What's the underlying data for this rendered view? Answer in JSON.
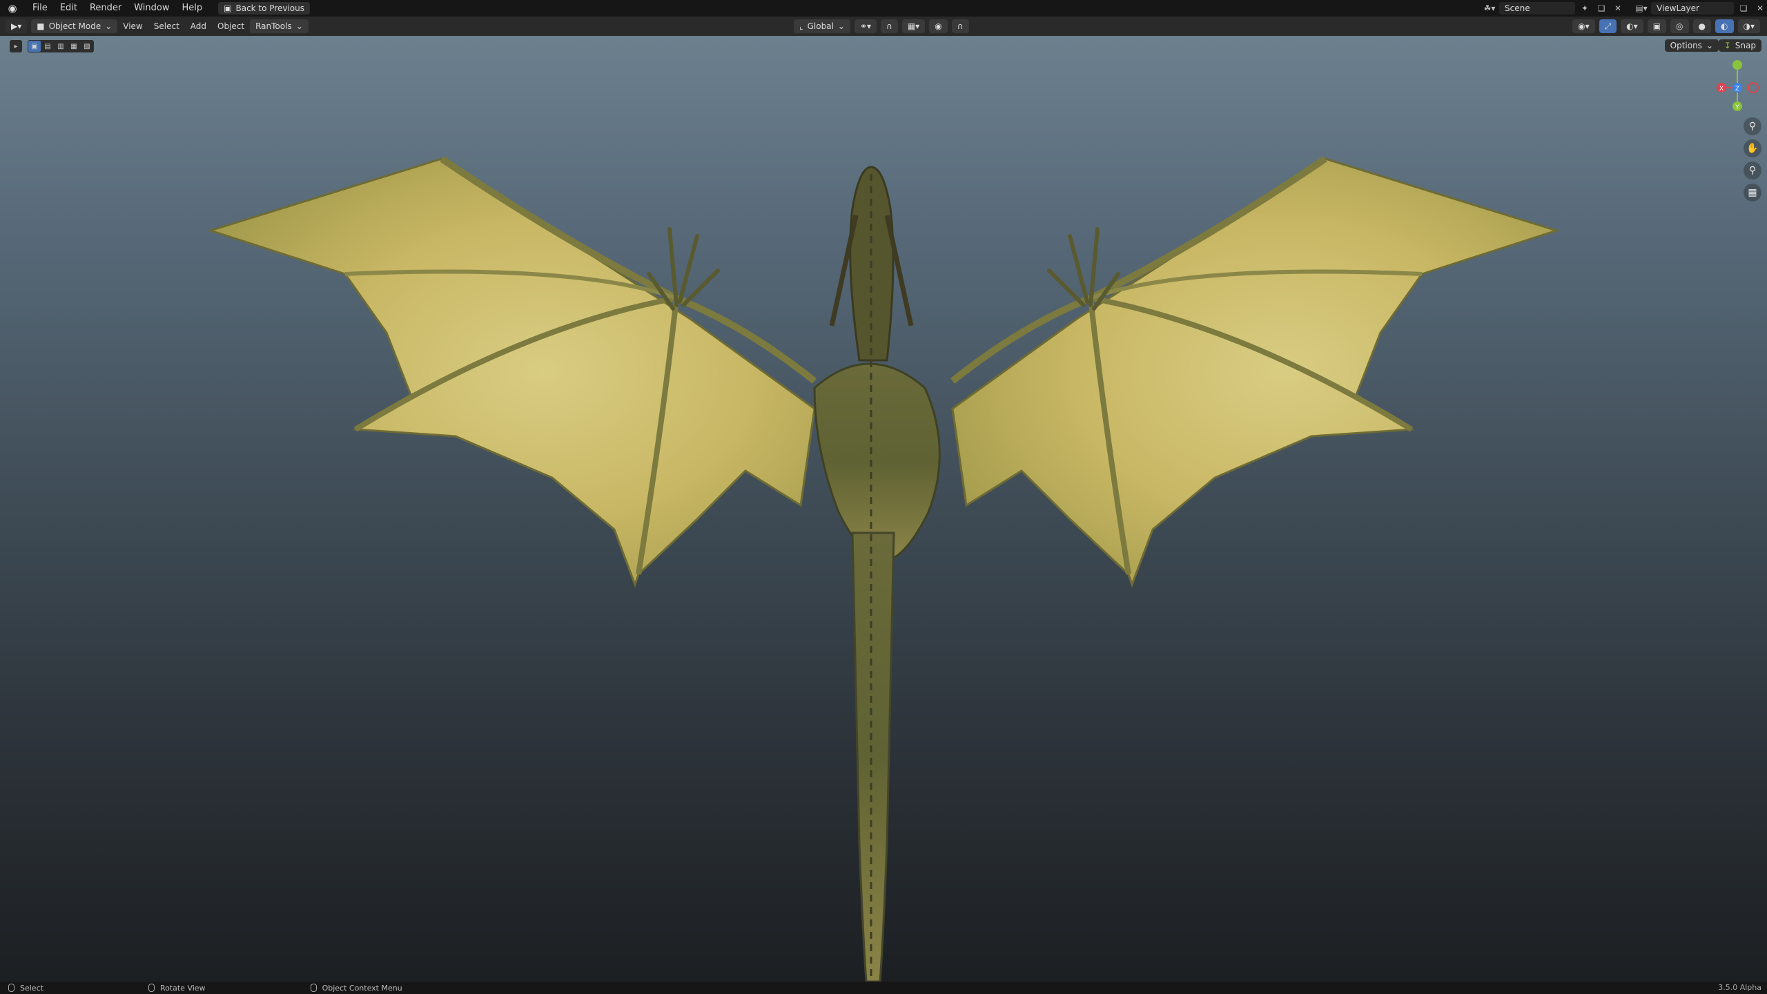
{
  "topbar": {
    "menus": [
      "File",
      "Edit",
      "Render",
      "Window",
      "Help"
    ],
    "back_button": "Back to Previous",
    "scene_label": "Scene",
    "view_layer_label": "ViewLayer"
  },
  "header": {
    "mode": "Object Mode",
    "menus": [
      "View",
      "Select",
      "Add",
      "Object",
      "RanTools"
    ],
    "transform_orientation": "Global",
    "options_label": "Options",
    "snap_label": "Snap"
  },
  "gizmo": {
    "x_label": "X",
    "y_label": "Y",
    "z_label": "Z",
    "colors": {
      "x": "#e0434f",
      "y": "#8ac43c",
      "z": "#3b82e8"
    }
  },
  "statusbar": {
    "items": [
      "Select",
      "Rotate View",
      "Object Context Menu"
    ],
    "version": "3.5.0 Alpha"
  },
  "icons": {
    "logo": "blender-logo-icon",
    "zoom": "zoom-icon",
    "pan": "hand-icon",
    "camera": "camera-icon",
    "ortho": "grid-icon"
  }
}
